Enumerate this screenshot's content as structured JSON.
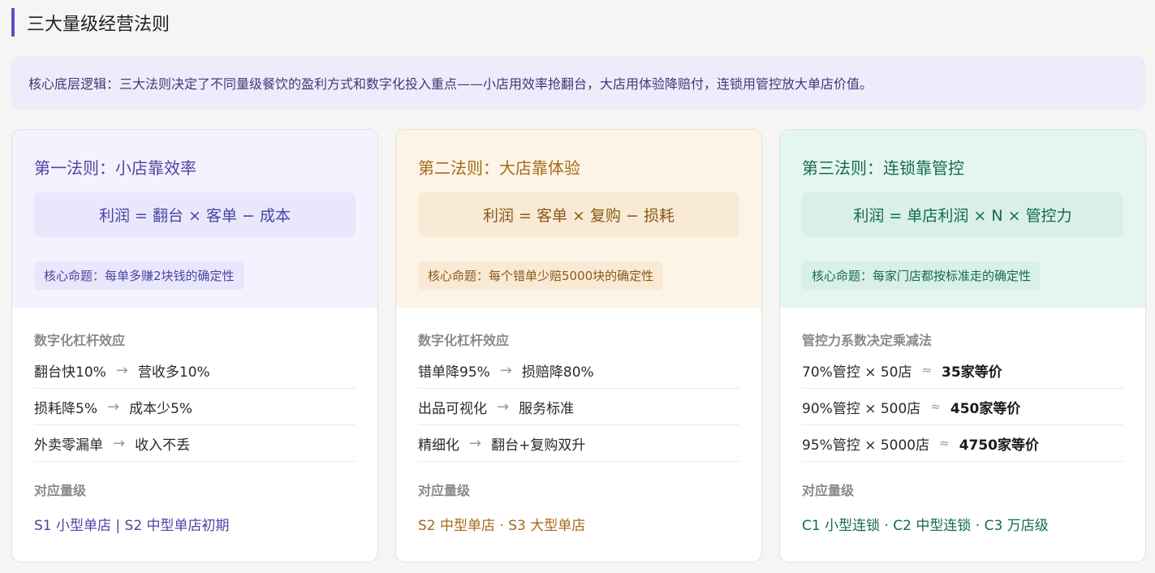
{
  "page": {
    "title": "三大量级经营法则",
    "callout": "核心底层逻辑：三大法则决定了不同量级餐饮的盈利方式和数字化投入重点——小店用效率抢翻台，大店用体验降赔付，连锁用管控放大单店价值。"
  },
  "cards": [
    {
      "title": "第一法则：小店靠效率",
      "formula": "利润 = 翻台 × 客单 − 成本",
      "proposition": "核心命题：每单多赚2块钱的确定性",
      "section_label": "数字化杠杆效应",
      "rows": [
        {
          "left": "翻台快10%",
          "arrow": "→",
          "right": "营收多10%"
        },
        {
          "left": "损耗降5%",
          "arrow": "→",
          "right": "成本少5%"
        },
        {
          "left": "外卖零漏单",
          "arrow": "→",
          "right": "收入不丢"
        }
      ],
      "levels_label": "对应量级",
      "levels": "S1 小型单店 | S2 中型单店初期"
    },
    {
      "title": "第二法则：大店靠体验",
      "formula": "利润 = 客单 × 复购 − 损耗",
      "proposition": "核心命题：每个错单少赔5000块的确定性",
      "section_label": "数字化杠杆效应",
      "rows": [
        {
          "left": "错单降95%",
          "arrow": "→",
          "right": "损赔降80%"
        },
        {
          "left": "出品可视化",
          "arrow": "→",
          "right": "服务标准"
        },
        {
          "left": "精细化",
          "arrow": "→",
          "right": "翻台+复购双升"
        }
      ],
      "levels_label": "对应量级",
      "levels": "S2 中型单店 · S3 大型单店"
    },
    {
      "title": "第三法则：连锁靠管控",
      "formula": "利润 = 单店利润 × N × 管控力",
      "proposition": "核心命题：每家门店都按标准走的确定性",
      "section_label": "管控力系数决定乘减法",
      "rows": [
        {
          "left": "70%管控 × 50店",
          "arrow": "≈",
          "right": "35家等价"
        },
        {
          "left": "90%管控 × 500店",
          "arrow": "≈",
          "right": "450家等价"
        },
        {
          "left": "95%管控 × 5000店",
          "arrow": "≈",
          "right": "4750家等价"
        }
      ],
      "levels_label": "对应量级",
      "levels": "C1 小型连锁 · C2 中型连锁 · C3 万店级"
    }
  ]
}
